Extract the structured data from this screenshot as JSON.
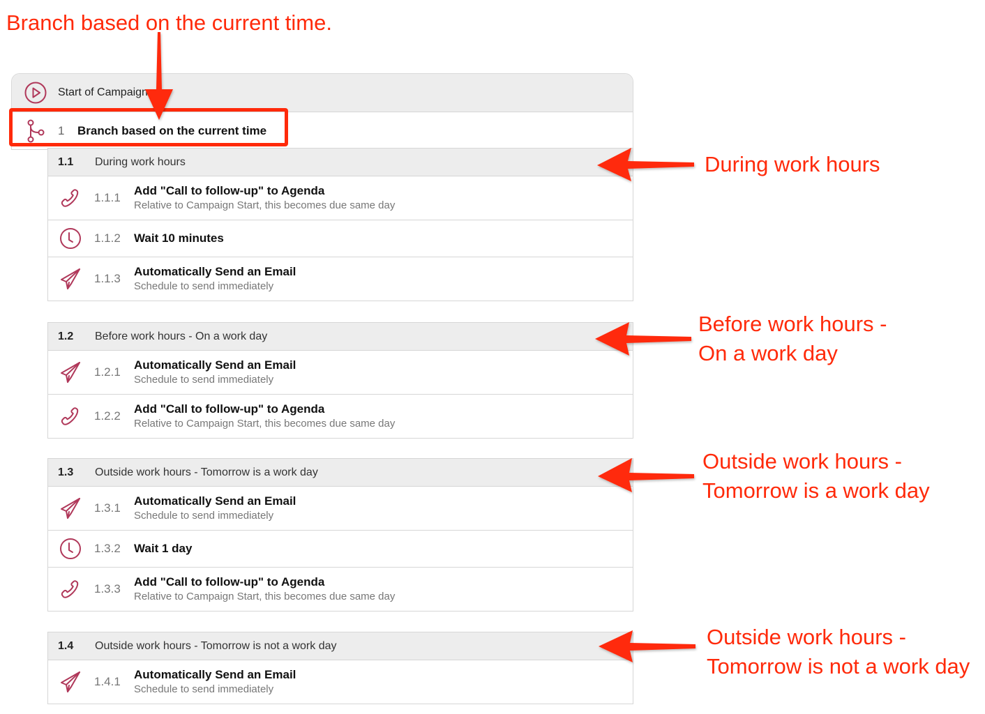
{
  "annotations": {
    "top": "Branch based on the current time.",
    "during": "During work hours",
    "before_line1": "Before work hours -",
    "before_line2": "On a work day",
    "outside_line1": "Outside work hours -",
    "outside_line2": "Tomorrow is a work day",
    "outside_not_line1": "Outside work hours -",
    "outside_not_line2": "Tomorrow is not a work day",
    "color": "#ff2a0a"
  },
  "campaign": {
    "start_label": "Start of Campaign",
    "start_icon": "play-circle-icon",
    "branch": {
      "icon": "branch-icon",
      "number": "1",
      "title": "Branch based on the current time"
    },
    "accent_color": "#b0385a",
    "sections": [
      {
        "number": "1.1",
        "title": "During work hours",
        "steps": [
          {
            "icon": "phone-icon",
            "number": "1.1.1",
            "title": "Add \"Call to follow-up\" to Agenda",
            "subtitle": "Relative to Campaign Start, this becomes due same day"
          },
          {
            "icon": "clock-icon",
            "number": "1.1.2",
            "title": "Wait 10 minutes",
            "subtitle": ""
          },
          {
            "icon": "send-icon",
            "number": "1.1.3",
            "title": "Automatically Send an Email",
            "subtitle": "Schedule to send immediately"
          }
        ]
      },
      {
        "number": "1.2",
        "title": "Before work hours - On a work day",
        "steps": [
          {
            "icon": "send-icon",
            "number": "1.2.1",
            "title": "Automatically Send an Email",
            "subtitle": "Schedule to send immediately"
          },
          {
            "icon": "phone-icon",
            "number": "1.2.2",
            "title": "Add \"Call to follow-up\" to Agenda",
            "subtitle": "Relative to Campaign Start, this becomes due same day"
          }
        ]
      },
      {
        "number": "1.3",
        "title": "Outside work hours - Tomorrow is a work day",
        "steps": [
          {
            "icon": "send-icon",
            "number": "1.3.1",
            "title": "Automatically Send an Email",
            "subtitle": "Schedule to send immediately"
          },
          {
            "icon": "clock-icon",
            "number": "1.3.2",
            "title": "Wait 1 day",
            "subtitle": ""
          },
          {
            "icon": "phone-icon",
            "number": "1.3.3",
            "title": "Add \"Call to follow-up\" to Agenda",
            "subtitle": "Relative to Campaign Start, this becomes due same day"
          }
        ]
      },
      {
        "number": "1.4",
        "title": "Outside work hours - Tomorrow is not a work day",
        "steps": [
          {
            "icon": "send-icon",
            "number": "1.4.1",
            "title": "Automatically Send an Email",
            "subtitle": "Schedule to send immediately"
          }
        ]
      }
    ]
  }
}
